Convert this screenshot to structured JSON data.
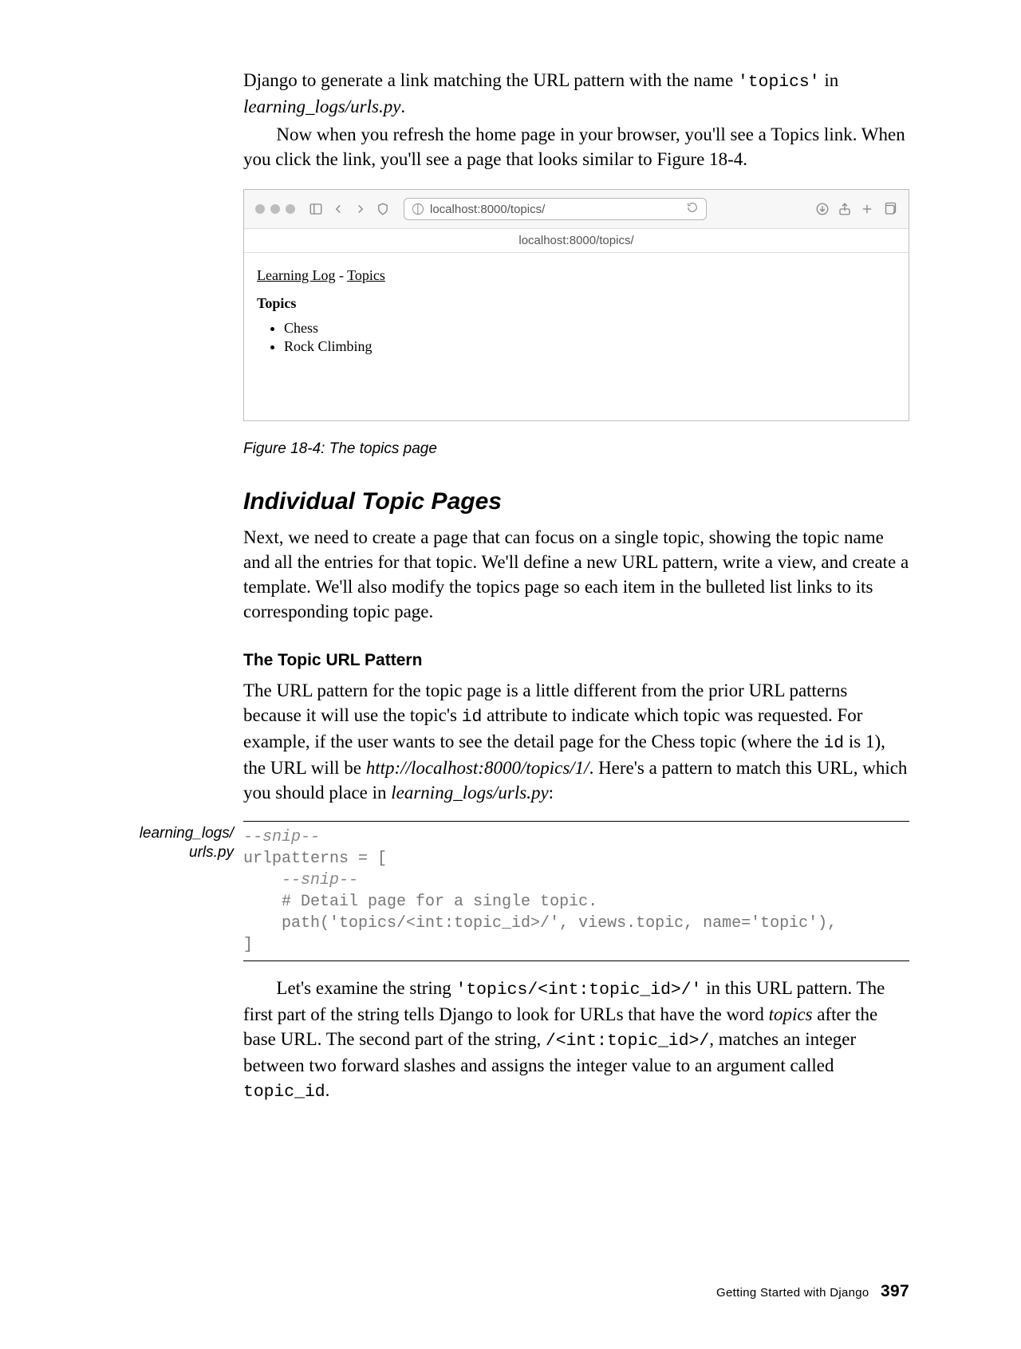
{
  "intro": {
    "para1_pre": "Django to generate a link matching the URL pattern with the name ",
    "para1_code": "'topics'",
    "para1_mid": " in ",
    "para1_ital": "learning_logs/urls.py",
    "para1_post": ".",
    "para2": "Now when you refresh the home page in your browser, you'll see a Topics link. When you click the link, you'll see a page that looks similar to Figure 18-4."
  },
  "browser": {
    "url": "localhost:8000/topics/",
    "tab_label": "localhost:8000/topics/",
    "nav_home": "Learning Log",
    "nav_sep": " - ",
    "nav_topics": "Topics",
    "heading": "Topics",
    "items": [
      "Chess",
      "Rock Climbing"
    ]
  },
  "figure_caption": "Figure 18-4: The topics page",
  "section": {
    "h2": "Individual Topic Pages",
    "p1": "Next, we need to create a page that can focus on a single topic, showing the topic name and all the entries for that topic. We'll define a new URL pattern, write a view, and create a template. We'll also modify the topics page so each item in the bulleted list links to its corresponding topic page.",
    "h3": "The Topic URL Pattern",
    "p2_a": "The URL pattern for the topic page is a little different from the prior URL patterns because it will use the topic's ",
    "p2_code1": "id",
    "p2_b": " attribute to indicate which topic was requested. For example, if the user wants to see the detail page for the Chess topic (where the ",
    "p2_code2": "id",
    "p2_c": " is 1), the URL will be ",
    "p2_url": "http://localhost:8000/topics/1/",
    "p2_d": ". Here's a pattern to match this URL, which you should place in ",
    "p2_file": "learning_logs/urls.py",
    "p2_e": ":"
  },
  "code": {
    "margin_label_1": "learning_logs/",
    "margin_label_2": "urls.py",
    "line1": "--snip--",
    "line2": "urlpatterns = [",
    "line3": "    --snip--",
    "line4": "    # Detail page for a single topic.",
    "line5": "    path('topics/<int:topic_id>/', views.topic, name='topic'),",
    "line6": "]"
  },
  "post": {
    "p_a": "Let's examine the string ",
    "p_code1": "'topics/<int:topic_id>/'",
    "p_b": " in this URL pattern. The first part of the string tells Django to look for URLs that have the word ",
    "p_ital1": "topics",
    "p_c": " after the base URL. The second part of the string, ",
    "p_code2": "/<int:topic_id>/",
    "p_d": ", matches an integer between two forward slashes and assigns the integer value to an argument called ",
    "p_code3": "topic_id",
    "p_e": "."
  },
  "footer": {
    "chapter": "Getting Started with Django",
    "page": "397"
  }
}
